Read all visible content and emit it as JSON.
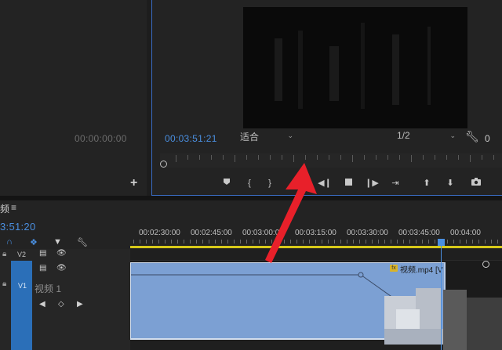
{
  "source": {
    "timecode": "00:00:00:00",
    "add_label": "+"
  },
  "program": {
    "timecode": "00:03:51:21",
    "fit_label": "适合",
    "resolution_label": "1/2",
    "duration_partial": "0",
    "transport_buttons": [
      "marker-icon",
      "in-point-icon",
      "out-point-icon",
      "go-to-in-icon",
      "step-back-icon",
      "stop-icon",
      "step-forward-icon",
      "go-to-out-icon",
      "lift-icon",
      "extract-icon",
      "export-frame-icon"
    ]
  },
  "timeline": {
    "tab_label": "频",
    "menu_label": "≡",
    "timecode": "3:51:20",
    "ruler_labels": [
      "00:02:30:00",
      "00:02:45:00",
      "00:03:00:00",
      "00:03:15:00",
      "00:03:30:00",
      "00:03:45:00",
      "00:04:00"
    ],
    "tracks": {
      "v2": {
        "label": "V2"
      },
      "v1": {
        "label": "V1",
        "name": "视频 1"
      }
    },
    "clip": {
      "fx": "fx",
      "name": "视频.mp4 [V"
    }
  },
  "colors": {
    "accent": "#4a8fe0",
    "clip": "#7ca0d3",
    "work_area": "#d7c91a",
    "arrow": "#e8202a"
  }
}
